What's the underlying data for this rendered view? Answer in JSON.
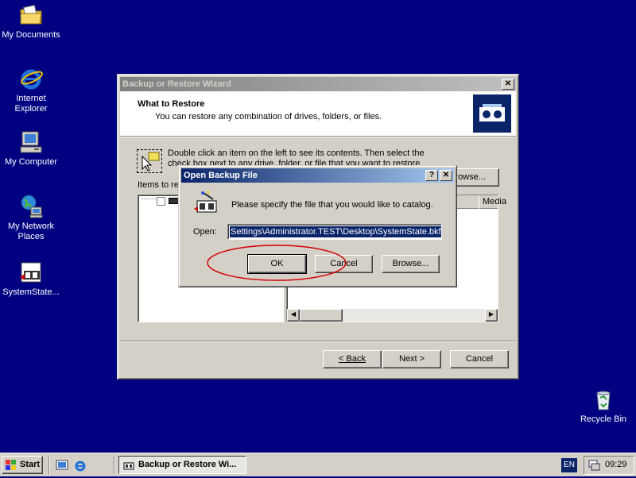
{
  "desktop": {
    "icons": [
      {
        "label": "My Documents",
        "icon": "folder-documents-icon"
      },
      {
        "label": "Internet Explorer",
        "icon": "internet-explorer-icon"
      },
      {
        "label": "My Computer",
        "icon": "computer-icon"
      },
      {
        "label": "My Network Places",
        "icon": "network-icon"
      },
      {
        "label": "SystemState...",
        "icon": "backup-file-icon"
      },
      {
        "label": "Recycle Bin",
        "icon": "recycle-bin-icon"
      }
    ]
  },
  "wizard": {
    "title": "Backup or Restore Wizard",
    "heading": "What to Restore",
    "subheading": "You can restore any combination of drives, folders, or files.",
    "instructions": "Double click an item on the left to see its contents. Then select the check box next to any drive, folder, or file that you want to restore.",
    "items_label": "Items to restore:",
    "browse_label": "Browse...",
    "column_media": "Media",
    "back_label": "< Back",
    "next_label": "Next >",
    "cancel_label": "Cancel"
  },
  "dialog": {
    "title": "Open Backup File",
    "help_label": "?",
    "close_label": "✕",
    "prompt": "Please specify the file that you would like to catalog.",
    "open_label": "Open:",
    "open_value": "Settings\\Administrator.TEST\\Desktop\\SystemState.bkf",
    "ok_label": "OK",
    "cancel_label": "Cancel",
    "browse_label": "Browse..."
  },
  "taskbar": {
    "start_label": "Start",
    "task_label": "Backup or Restore Wi...",
    "language": "EN",
    "clock": "09:29"
  },
  "colors": {
    "desktop": "#000080",
    "annotation": "#d40000"
  }
}
